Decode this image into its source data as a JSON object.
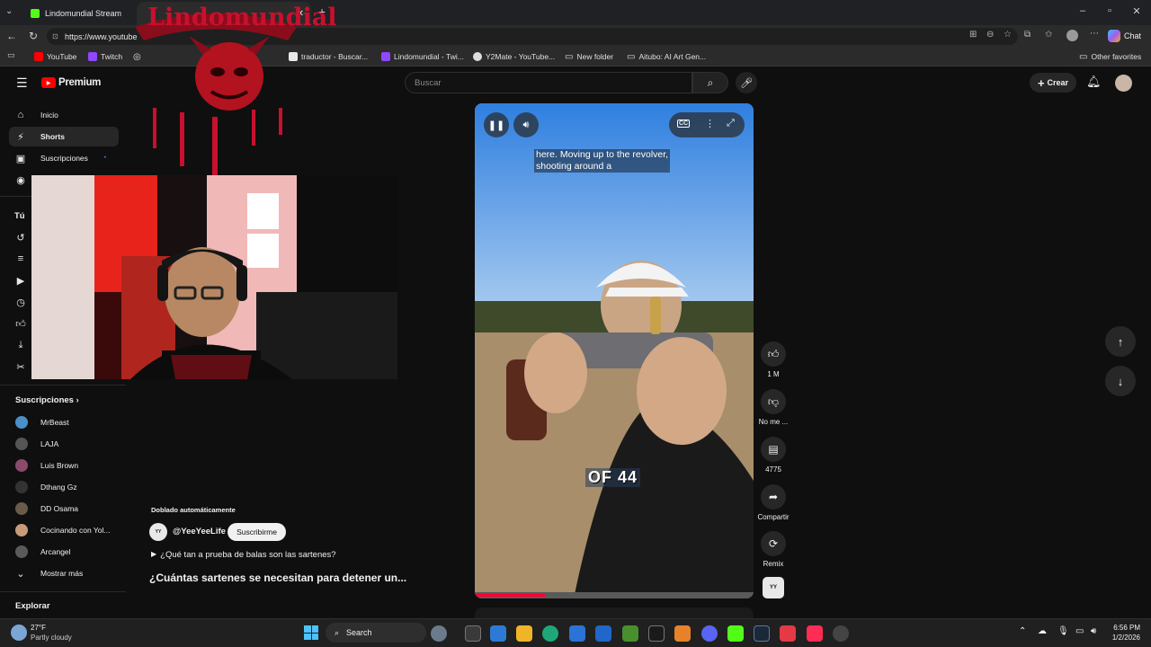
{
  "browser": {
    "tabs": [
      {
        "label": "Lindomundial Stream",
        "active": false
      },
      {
        "label": "",
        "active": true
      }
    ],
    "url": "https://www.youtube",
    "bookmarks": [
      "YouTube",
      "Twitch",
      "traductor - Buscar...",
      "Lindomundial - Twi...",
      "Y2Mate - YouTube...",
      "New folder",
      "Aitubo: AI Art Gen..."
    ],
    "other_favorites": "Other favorites",
    "chat_label": "Chat"
  },
  "youtube": {
    "logo": "Premium",
    "search_placeholder": "Buscar",
    "create_label": "Crear"
  },
  "sidebar": {
    "main": [
      {
        "label": "Inicio",
        "icon": "home-icon"
      },
      {
        "label": "Shorts",
        "icon": "shorts-icon",
        "selected": true
      },
      {
        "label": "Suscripciones",
        "icon": "subscriptions-icon"
      }
    ],
    "you_label": "Tú",
    "subs_header": "Suscripciones",
    "subs": [
      {
        "name": "MrBeast",
        "color": "#4a90c8"
      },
      {
        "name": "LAJA",
        "color": "#555555"
      },
      {
        "name": "Luis Brown",
        "color": "#8a4a6a"
      },
      {
        "name": "Dthang Gz",
        "color": "#333333"
      },
      {
        "name": "DD Osama",
        "color": "#6a5a4a"
      },
      {
        "name": "Cocinando con Yol...",
        "color": "#c89a7a"
      },
      {
        "name": "Arcangel",
        "color": "#5a5a5a"
      }
    ],
    "show_more": "Mostrar más",
    "explore": "Explorar"
  },
  "short": {
    "dubbed": "Doblado automáticamente",
    "channel": "@YeeYeeLife",
    "subscribe": "Suscribirme",
    "description": "¿Qué tan a prueba de balas son las sartenes?",
    "title": "¿Cuántas sartenes se necesitan para detener un...",
    "caption": [
      "here. Moving up to the revolver,",
      "shooting around a"
    ],
    "overlay_text": "OF 44",
    "progress": 0.25,
    "actions": {
      "likes": "1 M",
      "dislike": "No me ...",
      "comments": "4775",
      "share": "Compartir",
      "remix": "Remix"
    }
  },
  "overlay": {
    "streamer_logo_text": "Lindomundial"
  },
  "taskbar": {
    "weather_temp": "27°F",
    "weather_desc": "Partly cloudy",
    "search": "Search",
    "time": "6:56 PM",
    "date": "1/2/2026"
  },
  "colors": {
    "accent_red": "#ff0000",
    "overlay_red": "#c8102e",
    "yt_bg": "#0f0f0f"
  }
}
